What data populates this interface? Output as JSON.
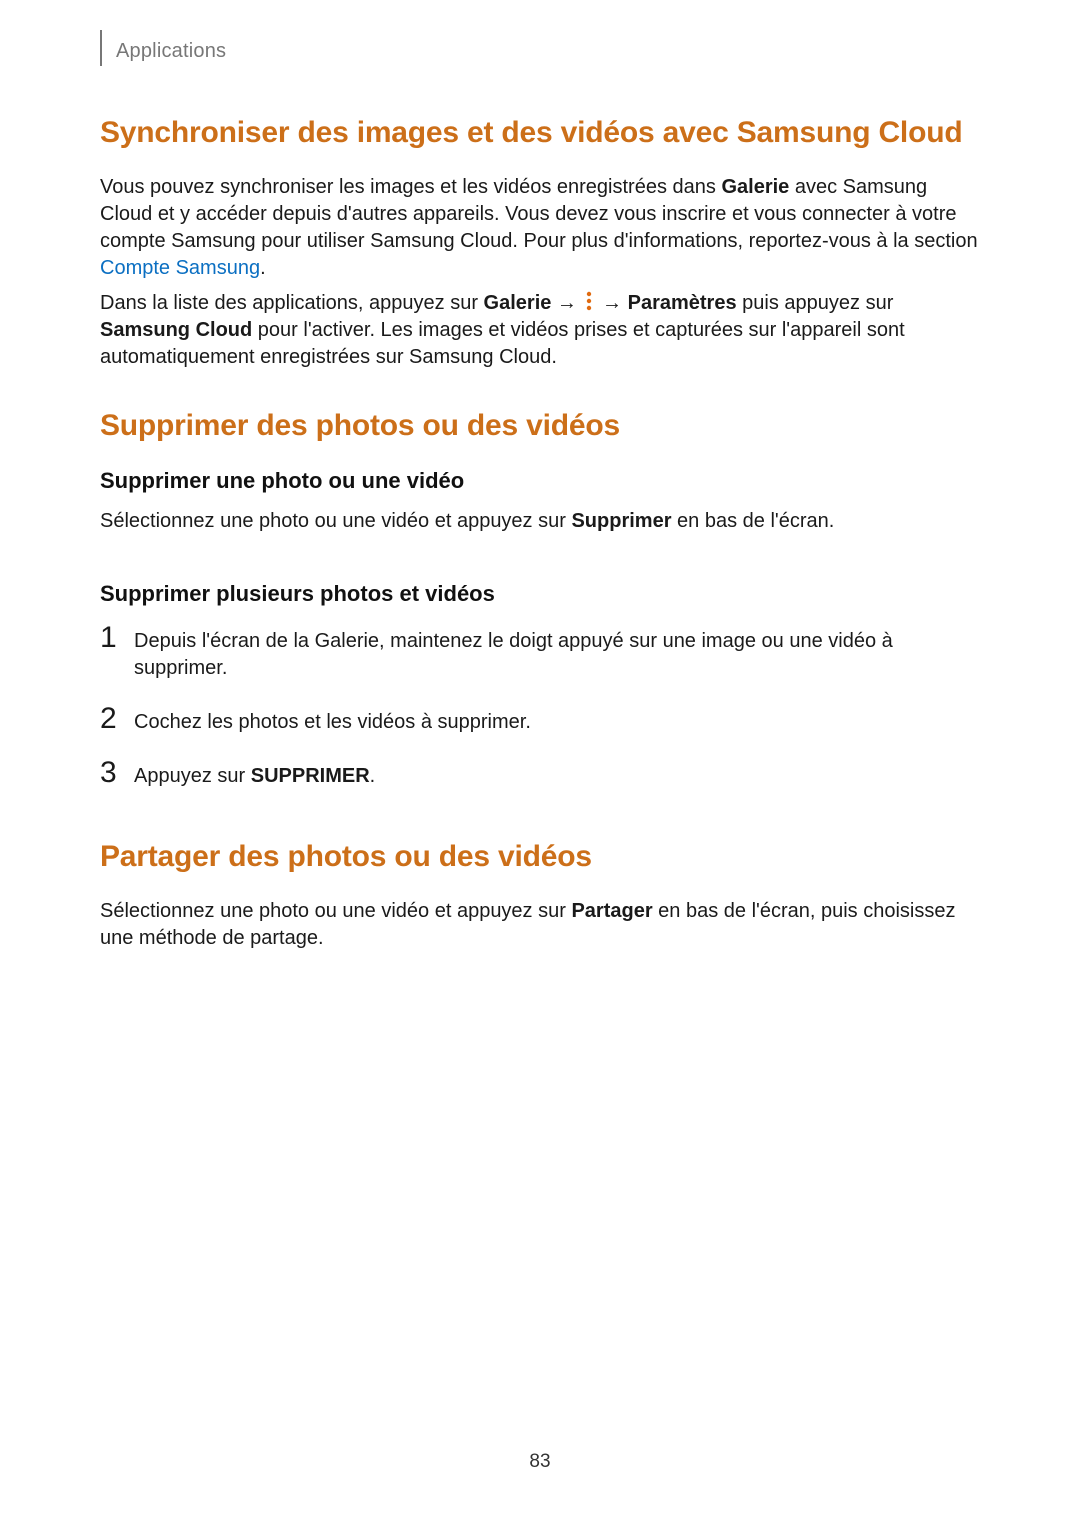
{
  "header": {
    "section": "Applications"
  },
  "sync": {
    "title": "Synchroniser des images et des vidéos avec Samsung Cloud",
    "p1_a": "Vous pouvez synchroniser les images et les vidéos enregistrées dans ",
    "p1_gallery": "Galerie",
    "p1_b": " avec Samsung Cloud et y accéder depuis d'autres appareils. Vous devez vous inscrire et vous connecter à votre compte Samsung pour utiliser Samsung Cloud. Pour plus d'informations, reportez-vous à la section ",
    "p1_link": "Compte Samsung",
    "p1_c": ".",
    "p2_a": "Dans la liste des applications, appuyez sur ",
    "p2_gallery": "Galerie",
    "p2_arrow1": " → ",
    "p2_arrow2": " → ",
    "p2_settings": "Paramètres",
    "p2_b": " puis appuyez sur ",
    "p2_samsung": "Samsung Cloud",
    "p2_c": " pour l'activer. Les images et vidéos prises et capturées sur l'appareil sont automatiquement enregistrées sur Samsung Cloud."
  },
  "delete": {
    "title": "Supprimer des photos ou des vidéos",
    "sub1": "Supprimer une photo ou une vidéo",
    "sub1_p_a": "Sélectionnez une photo ou une vidéo et appuyez sur ",
    "sub1_p_b": "Supprimer",
    "sub1_p_c": " en bas de l'écran.",
    "sub2": "Supprimer plusieurs photos et vidéos",
    "steps": [
      {
        "n": "1",
        "t": "Depuis l'écran de la Galerie, maintenez le doigt appuyé sur une image ou une vidéo à supprimer."
      },
      {
        "n": "2",
        "t": "Cochez les photos et les vidéos à supprimer."
      },
      {
        "n": "3",
        "t_a": "Appuyez sur ",
        "t_b": "SUPPRIMER",
        "t_c": "."
      }
    ]
  },
  "share": {
    "title": "Partager des photos ou des vidéos",
    "p_a": "Sélectionnez une photo ou une vidéo et appuyez sur ",
    "p_b": "Partager",
    "p_c": " en bas de l'écran, puis choisissez une méthode de partage."
  },
  "page_number": "83",
  "icons": {
    "more_vertical": "more-options-icon"
  }
}
